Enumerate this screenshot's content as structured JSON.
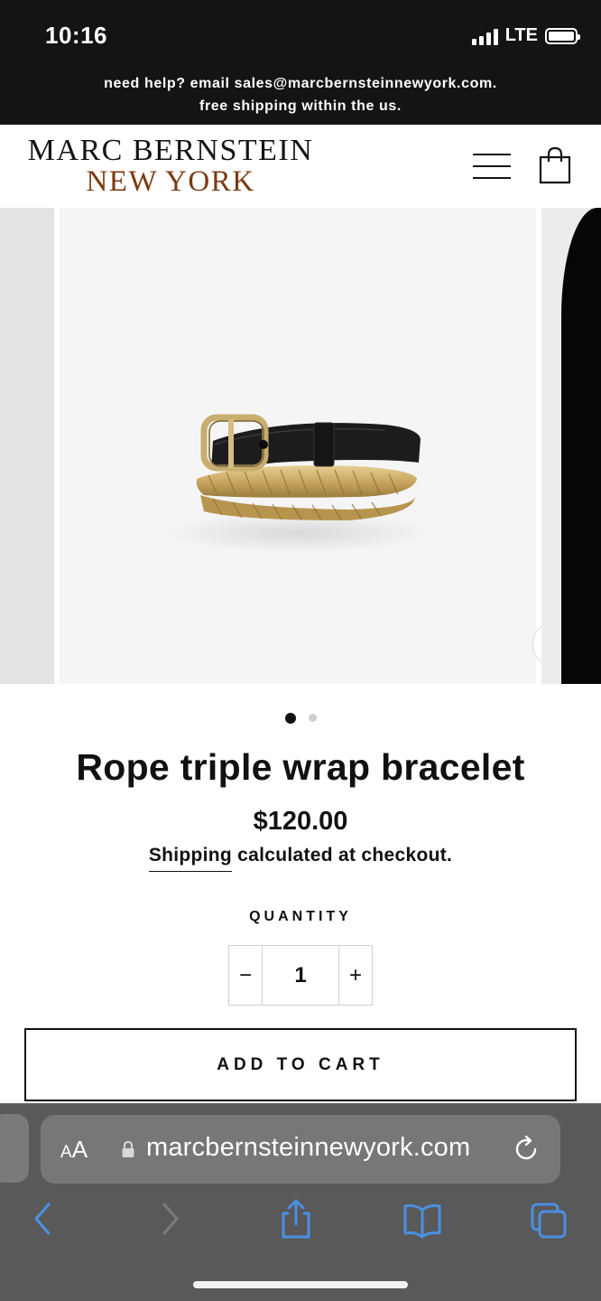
{
  "status_bar": {
    "time": "10:16",
    "network": "LTE"
  },
  "announcement": {
    "line1": "need help? email sales@marcbernsteinnewyork.com.",
    "line2": "free shipping within the us."
  },
  "header": {
    "logo_line1": "MARC BERNSTEIN",
    "logo_line2": "NEW YORK",
    "logo_color": "#7b3a12",
    "menu_icon": "hamburger-menu-icon",
    "cart_icon": "shopping-bag-icon"
  },
  "gallery": {
    "image_alt": "gold rope triple wrap bracelet with black leather strap and buckle",
    "zoom_icon": "zoom-search-icon",
    "pagination": {
      "current": 1,
      "total": 2
    }
  },
  "product": {
    "title": "Rope triple wrap bracelet",
    "price": "$120.00",
    "shipping_link": "Shipping",
    "shipping_text": " calculated at checkout."
  },
  "quantity": {
    "label": "QUANTITY",
    "minus": "−",
    "value": "1",
    "plus": "+"
  },
  "add_to_cart": {
    "label": "ADD TO CART"
  },
  "browser": {
    "text_size_label_small": "A",
    "text_size_label_large": "A",
    "url": "marcbernsteinnewyork.com",
    "icons": [
      "back-icon",
      "forward-icon",
      "share-icon",
      "bookmarks-icon",
      "tabs-icon"
    ],
    "accent": "#4a90e2"
  }
}
